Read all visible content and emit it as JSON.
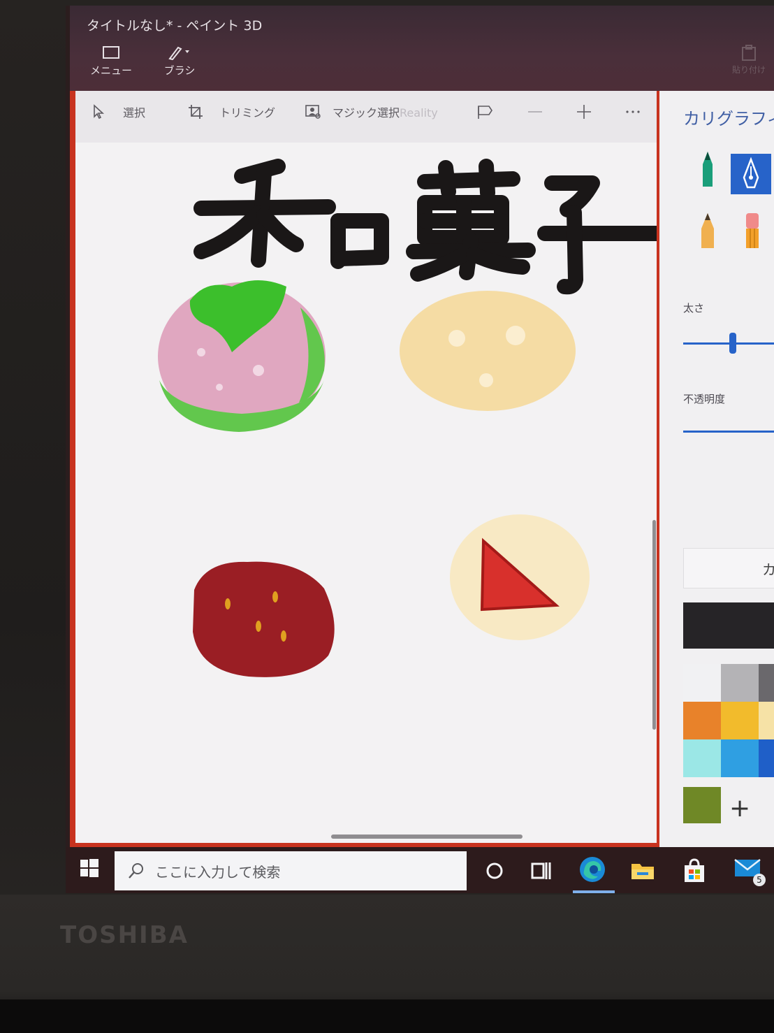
{
  "window": {
    "title": "タイトルなし* - ペイント 3D"
  },
  "ribbon": {
    "menu_label": "メニュー",
    "brush_label": "ブラシ",
    "paste_label": "貼り付け"
  },
  "toolbar": {
    "select_label": "選択",
    "crop_label": "トリミング",
    "magic_select_label": "マジック選択",
    "magic_select_suffix": "Reality"
  },
  "canvas": {
    "drawn_text": "和 菓 子"
  },
  "side_panel": {
    "title": "カリグラフィ ペ",
    "thickness_label": "太さ",
    "thickness_level": 0.3,
    "opacity_label": "不透明度",
    "opacity_level": 1.0,
    "custom_color_label": "カ",
    "current_color": "#262427",
    "swatches": [
      "#f1f1f3",
      "#b4b3b6",
      "#6a686c",
      "#e8822a",
      "#f2bb2c",
      "#f6e2a6",
      "#9be7e6",
      "#2f9fe2",
      "#1f5fc8"
    ],
    "custom_swatch": "#6f8826",
    "add_color_label": "+"
  },
  "taskbar": {
    "search_placeholder": "ここに入力して検索",
    "mail_badge": "5"
  },
  "monitor": {
    "brand": "TOSHIBA"
  },
  "colors": {
    "accent": "#2763c9",
    "window_border": "#c8331f",
    "titlebar": "#4a2f3a"
  }
}
